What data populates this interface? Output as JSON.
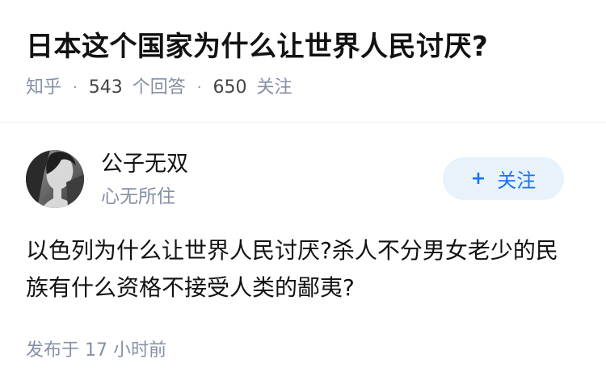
{
  "question": {
    "title": "日本这个国家为什么让世界人民讨厌?",
    "source": "知乎",
    "answer_count": "543",
    "answer_label": "个回答",
    "follower_count": "650",
    "follower_label": "关注",
    "separator": "·"
  },
  "author": {
    "name": "公子无双",
    "bio": "心无所住",
    "follow_label": "关注",
    "follow_icon": "plus-icon"
  },
  "answer": {
    "text": "以色列为什么让世界人民讨厌?杀人不分男女老少的民族有什么资格不接受人类的鄙夷?",
    "published_label": "发布于",
    "published_time": "17 小时前"
  },
  "colors": {
    "text_primary": "#121212",
    "text_secondary": "#8590a6",
    "accent": "#1772f6",
    "follow_bg": "#e8f2fb"
  }
}
